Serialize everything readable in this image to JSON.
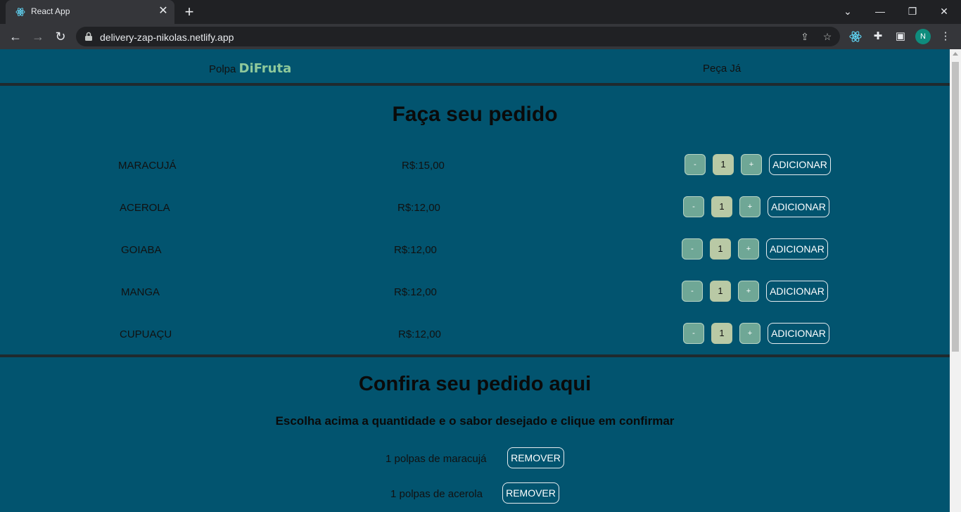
{
  "browser": {
    "tab_title": "React App",
    "url": "delivery-zap-nikolas.netlify.app",
    "profile_initial": "N"
  },
  "header": {
    "brand_prefix": "Polpa",
    "brand_accent": "DiFruta",
    "nav_link": "Peça Já"
  },
  "order": {
    "title": "Faça seu pedido",
    "minus_label": "-",
    "plus_label": "+",
    "add_label": "ADICIONAR",
    "products": [
      {
        "name": "MARACUJÁ",
        "price": "R$:15,00",
        "quantity": "1"
      },
      {
        "name": "ACEROLA",
        "price": "R$:12,00",
        "quantity": "1"
      },
      {
        "name": "GOIABA",
        "price": "R$:12,00",
        "quantity": "1"
      },
      {
        "name": "MANGA",
        "price": "R$:12,00",
        "quantity": "1"
      },
      {
        "name": "CUPUAÇU",
        "price": "R$:12,00",
        "quantity": "1"
      }
    ]
  },
  "review": {
    "title": "Confira seu pedido aqui",
    "subtitle": "Escolha acima a quantidade e o sabor desejado e clique em confirmar",
    "remove_label": "REMOVER",
    "items": [
      {
        "text": "1 polpas de maracujá"
      },
      {
        "text": "1 polpas de acerola"
      }
    ]
  }
}
